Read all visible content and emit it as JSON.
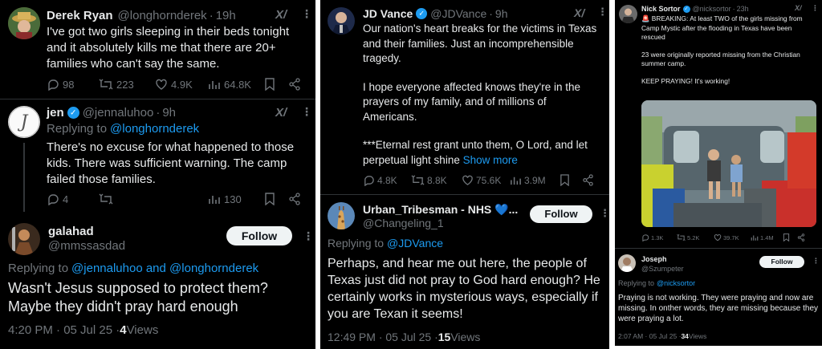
{
  "colors": {
    "background": "#000000",
    "text": "#e7e9ea",
    "muted": "#71767b",
    "accent": "#1d9bf0",
    "button": "#eff3f4"
  },
  "panel_left": {
    "tweet1": {
      "name": "Derek Ryan",
      "handle": "@longhornderek",
      "time": "19h",
      "text": "I've got two girls sleeping in their beds tonight and it absolutely kills me that there are 20+ families who can't say the same.",
      "replies": "98",
      "reposts": "223",
      "likes": "4.9K",
      "views": "64.8K"
    },
    "tweet2": {
      "name": "jen",
      "handle": "@jennaluhoo",
      "time": "9h",
      "replying_label": "Replying to",
      "replying_to": "@longhornderek",
      "text": "There's no excuse for what happened to those kids. There was sufficient warning. The camp failed those families.",
      "replies": "4",
      "views": "130"
    },
    "tweet3": {
      "name": "galahad",
      "handle": "@mmssasdad",
      "follow": "Follow",
      "replying_label": "Replying to",
      "replying_to": "@jennaluhoo and @longhornderek",
      "text": "Wasn't Jesus supposed to protect them? Maybe they didn't pray hard enough",
      "timestamp": "4:20 PM · 05 Jul 25 · ",
      "views_count": "4",
      "views_label": " Views"
    }
  },
  "panel_mid": {
    "tweet1": {
      "name": "JD Vance",
      "handle": "@JDVance",
      "time": "9h",
      "para1": "Our nation's heart breaks for the victims in Texas and their families. Just an incomprehensible tragedy.",
      "para2": "I hope everyone affected knows they're in the prayers of my family, and of millions of Americans.",
      "para3": "***Eternal rest grant unto them, O Lord, and let perpetual light shine",
      "show_more": "Show more",
      "replies": "4.8K",
      "reposts": "8.8K",
      "likes": "75.6K",
      "views": "3.9M"
    },
    "tweet2": {
      "name": "Urban_Tribesman - NHS 💙...",
      "handle": "@Changeling_1",
      "follow": "Follow",
      "replying_label": "Replying to",
      "replying_to": "@JDVance",
      "text": "Perhaps, and hear me out here, the people of Texas just did not pray to God hard enough? He certainly works in mysterious ways, especially if you are Texan it seems!",
      "timestamp": "12:49 PM · 05 Jul 25 · ",
      "views_count": "15",
      "views_label": " Views"
    }
  },
  "panel_right": {
    "tweet1": {
      "name": "Nick Sortor",
      "handle": "@nicksortor",
      "time": "23h",
      "para1": "🚨 BREAKING: At least TWO of the girls missing from Camp Mystic after the flooding in Texas have been rescued",
      "para2": "23 were originally reported missing from the Christian summer camp.",
      "para3": "KEEP PRAYING! It's working!",
      "replies": "1.3K",
      "reposts": "5.2K",
      "likes": "39.7K",
      "views": "1.4M"
    },
    "tweet2": {
      "name": "Joseph",
      "handle": "@Szumpeter",
      "follow": "Follow",
      "replying_label": "Replying to",
      "replying_to": "@nicksortor",
      "text": "Praying is not working. They were praying and now are missing. In onther words, they are missing because they were praying a lot.",
      "timestamp": "2:07 AM · 05 Jul 25 · ",
      "views_count": "34",
      "views_label": " Views"
    }
  }
}
